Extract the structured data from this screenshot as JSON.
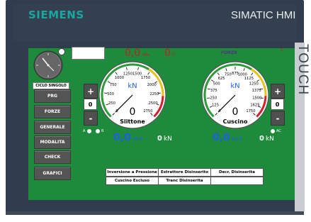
{
  "header": {
    "brand": "SIEMENS",
    "model": "SIMATIC HMI",
    "touch": "TOUCH"
  },
  "top": {
    "pressure_value": "0,0",
    "pressure_unit": "MPa",
    "temp_value": "0",
    "temp_unit": "°C",
    "forza": "FORZA",
    "marker": "0"
  },
  "menu": [
    "CICLO SINGOLO",
    "PRG",
    "FORZE",
    "GENERALE",
    "MODALITA",
    "CHECK",
    "GRAFICI"
  ],
  "left_gauge": {
    "unit": "kN",
    "value": "0",
    "name": "Slittone",
    "ticks": [
      "0",
      "250",
      "500",
      "750",
      "1000",
      "1250",
      "1500",
      "1750",
      "2000",
      "2250",
      "2500",
      "2750"
    ]
  },
  "right_gauge": {
    "unit": "kN",
    "value": "0",
    "name": "Cuscino",
    "ticks": [
      "0",
      "125",
      "250",
      "375",
      "500",
      "625",
      "750",
      "875",
      "1000",
      "1125",
      "1250",
      "1375",
      "1500",
      "1625",
      "1750"
    ]
  },
  "left_controls": {
    "plus": "+",
    "value": "0",
    "minus": "-",
    "a_label": "A",
    "b_label": "B"
  },
  "right_controls": {
    "plus": "+",
    "value": "0",
    "minus": "-",
    "ac_label": "AC"
  },
  "readouts": {
    "left_mm": "0,0",
    "mm_unit": "mm",
    "left_kn": "0",
    "kn_unit": "kN",
    "right_mm": "0,0",
    "right_kn": "0"
  },
  "status": {
    "row1": [
      "Inversione a Pressione",
      "Estrattore Disinserito",
      "Decr. Disinserita"
    ],
    "row2": [
      "Cuscino Escluso",
      "Tranc Disinserita",
      ""
    ]
  },
  "colors": {
    "screen": "#1e8a3b",
    "frame": "#2f3d4c",
    "accent": "#1aa6a0",
    "blue": "#1e5fe5",
    "red": "#c02025"
  }
}
